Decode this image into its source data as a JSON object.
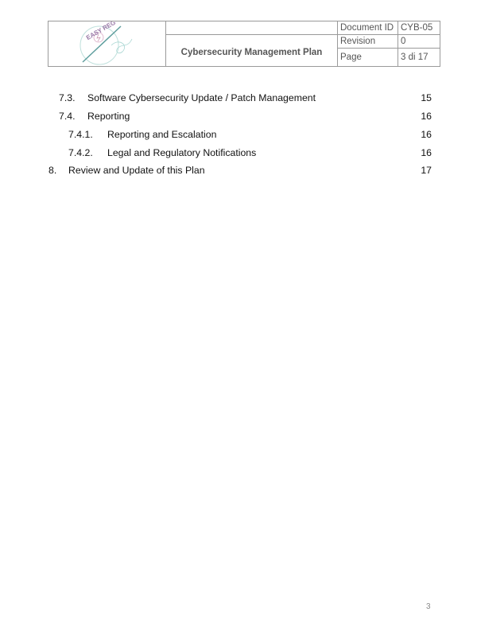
{
  "header": {
    "logo_text": "EASY REG",
    "title": "Cybersecurity Management Plan",
    "fields": [
      {
        "label": "Document ID",
        "value": "CYB-05"
      },
      {
        "label": "Revision",
        "value": "0"
      },
      {
        "label": "Page",
        "value": "3 di 17"
      }
    ]
  },
  "toc": {
    "entries": [
      {
        "number": "7.3.",
        "title": "Software Cybersecurity Update / Patch Management",
        "page": "15",
        "level": 2
      },
      {
        "number": "7.4.",
        "title": "Reporting",
        "page": "16",
        "level": 2
      },
      {
        "number": "7.4.1.",
        "title": "Reporting and Escalation",
        "page": "16",
        "level": 3
      },
      {
        "number": "7.4.2.",
        "title": "Legal and Regulatory Notifications",
        "page": "16",
        "level": 3
      },
      {
        "number": "8.",
        "title": "Review and Update of this Plan",
        "page": "17",
        "level": 1
      }
    ]
  },
  "footer": {
    "page_number": "3"
  },
  "colors": {
    "border": "#9a9a9a",
    "header_text": "#555555",
    "logo_purple": "#8a6a9a",
    "logo_teal": "#4f9a9a"
  }
}
